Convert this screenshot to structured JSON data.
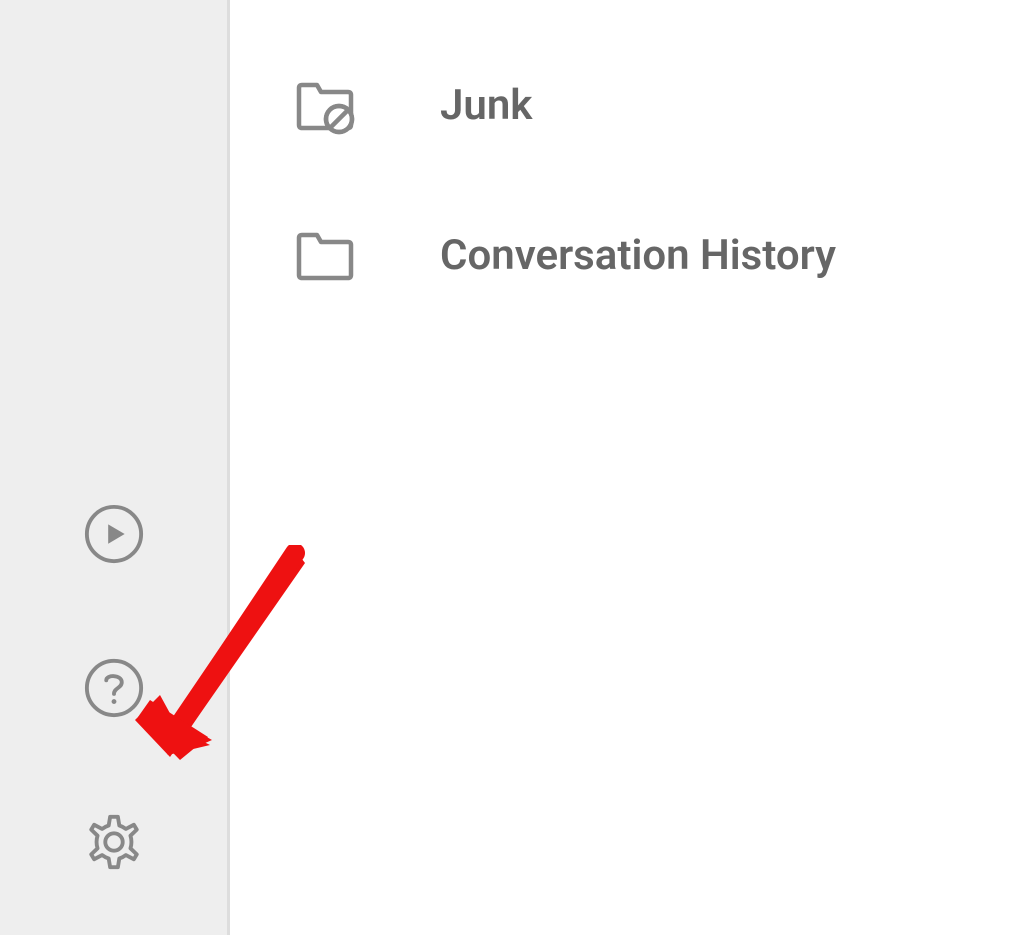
{
  "sidebar_icons": {
    "play": "play-icon",
    "help": "help-icon",
    "settings": "gear-icon"
  },
  "folders": [
    {
      "label": "Junk",
      "icon": "folder-junk-icon"
    },
    {
      "label": "Conversation History",
      "icon": "folder-icon"
    }
  ],
  "colors": {
    "icon_stroke": "#888888",
    "text": "#666666",
    "sidebar_bg": "#eeeeee",
    "arrow": "#ee1111"
  }
}
